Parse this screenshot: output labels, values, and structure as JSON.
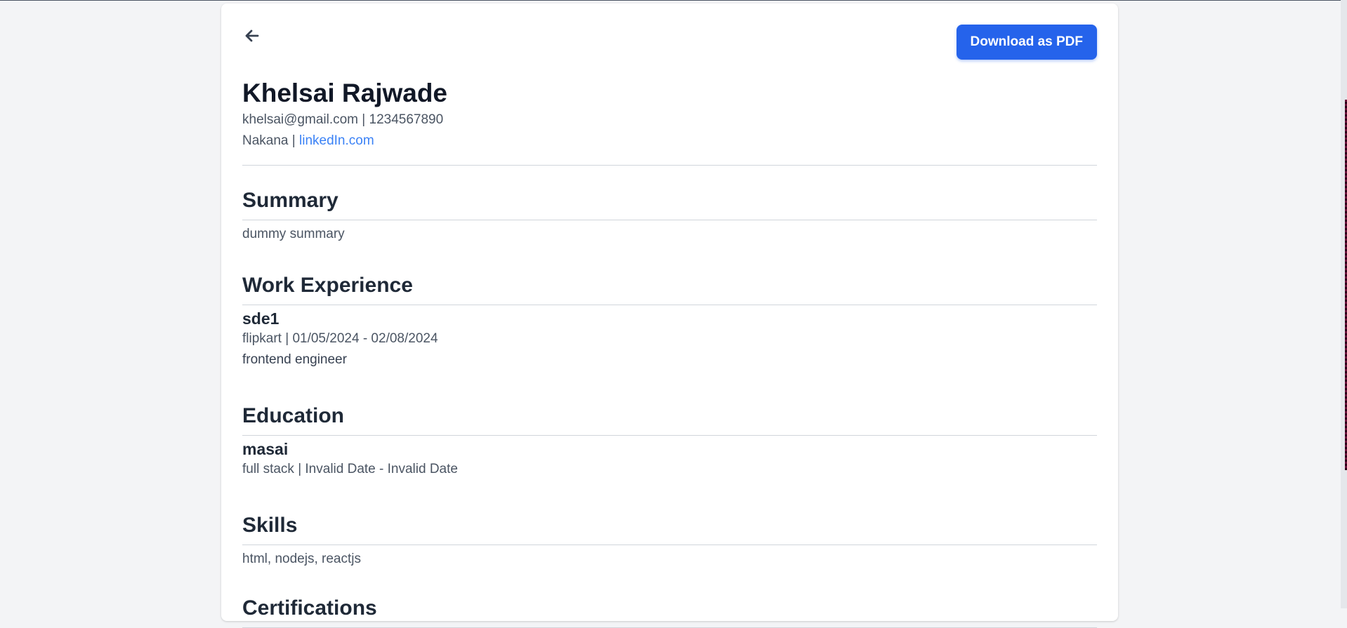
{
  "page": {
    "accent_color": "#2563eb",
    "link_color": "#3b82f6"
  },
  "toolbar": {
    "back_icon": "arrow-left-icon",
    "download_label": "Download as PDF"
  },
  "header": {
    "name": "Khelsai Rajwade",
    "email": "khelsai@gmail.com",
    "separator": " | ",
    "phone": "1234567890",
    "location": "Nakana",
    "linkedin_label": "linkedIn.com"
  },
  "summary": {
    "title": "Summary",
    "text": "dummy summary"
  },
  "work": {
    "title": "Work Experience",
    "items": [
      {
        "role": "sde1",
        "meta": "flipkart | 01/05/2024 - 02/08/2024",
        "description": "frontend engineer"
      }
    ]
  },
  "education": {
    "title": "Education",
    "items": [
      {
        "institution": "masai",
        "meta": "full stack | Invalid Date - Invalid Date"
      }
    ]
  },
  "skills": {
    "title": "Skills",
    "text": "html, nodejs, reactjs"
  },
  "certifications": {
    "title": "Certifications"
  }
}
